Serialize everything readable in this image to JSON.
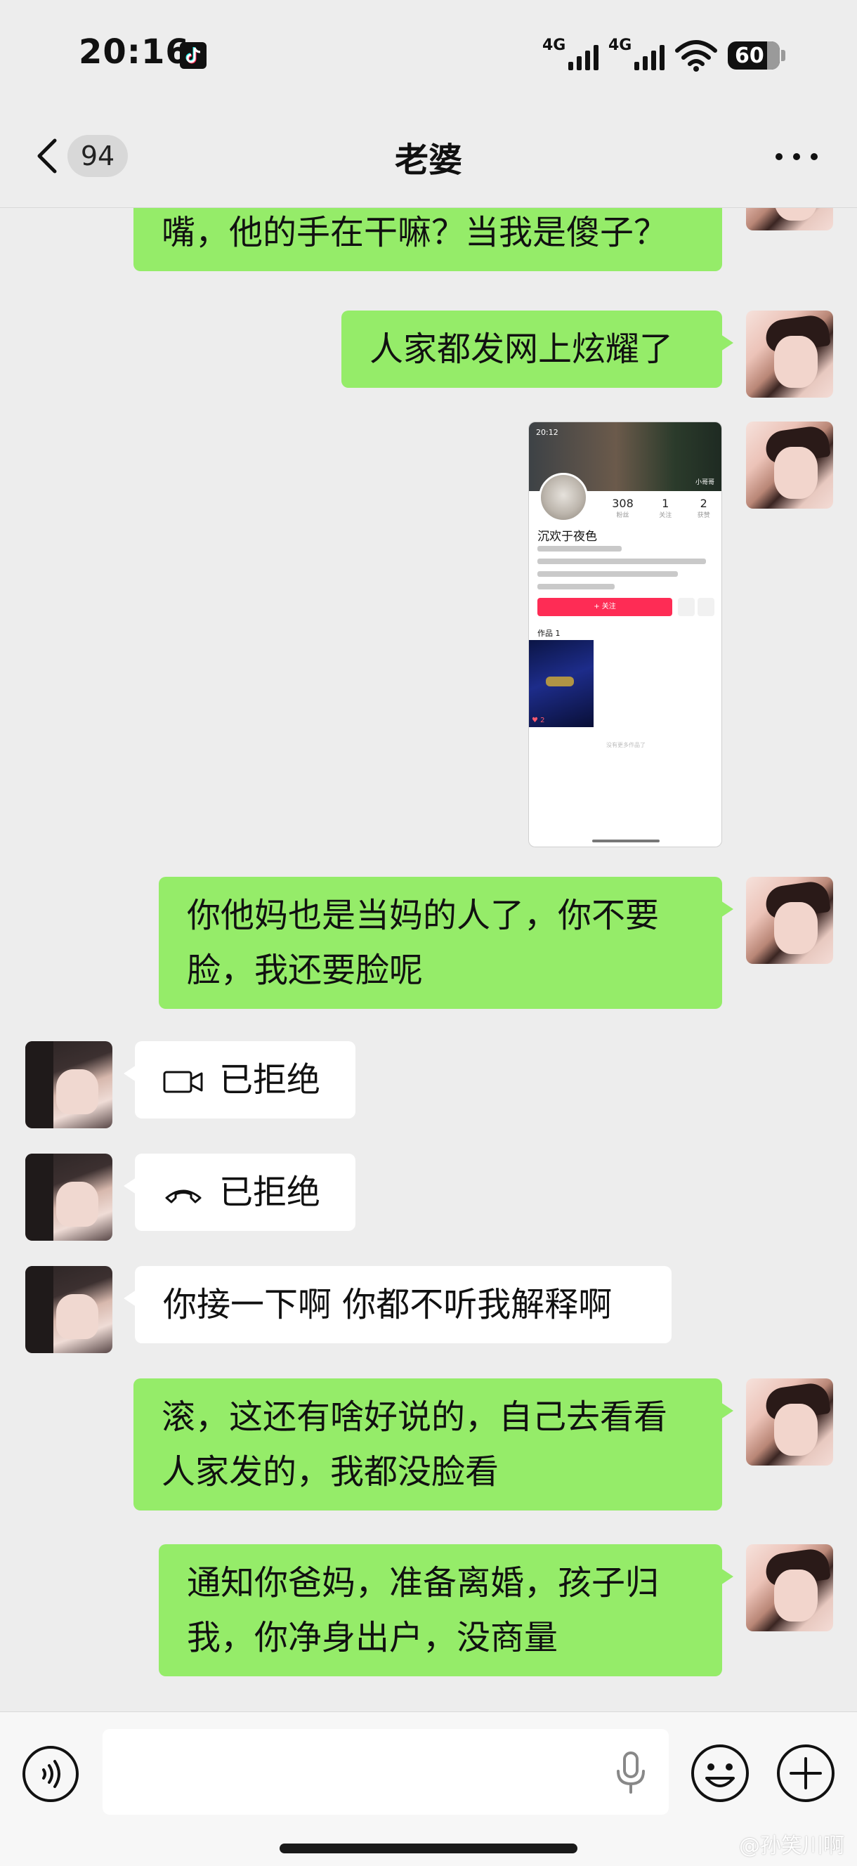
{
  "status_bar": {
    "time": "20:16",
    "network_1": "4G",
    "network_2": "4G",
    "battery": "60",
    "icons": [
      "tiktok-icon",
      "signal-icon",
      "signal-icon",
      "wifi-icon",
      "battery-icon"
    ]
  },
  "header": {
    "unread_count": "94",
    "title": "老婆",
    "icons": [
      "back-icon",
      "more-icon"
    ]
  },
  "messages": [
    {
      "side": "right",
      "type": "text",
      "text": "嘴，他的手在干嘛？当我是傻子？"
    },
    {
      "side": "right",
      "type": "text",
      "text": "人家都发网上炫耀了"
    },
    {
      "side": "right",
      "type": "image",
      "screenshot": {
        "time": "20:12",
        "banner_label": "小哥哥",
        "stats": [
          {
            "value": "308",
            "label": "粉丝"
          },
          {
            "value": "1",
            "label": "关注"
          },
          {
            "value": "2",
            "label": "获赞"
          }
        ],
        "nickname": "沉欢于夜色",
        "follow_button": "+ 关注",
        "works_label": "作品 1",
        "likes": "♥ 2",
        "end_tip": "没有更多作品了"
      }
    },
    {
      "side": "right",
      "type": "text",
      "lines": [
        "你他妈也是当妈的人了，你不要",
        "脸，我还要脸呢"
      ]
    },
    {
      "side": "left",
      "type": "call",
      "call_kind": "video",
      "text": "已拒绝"
    },
    {
      "side": "left",
      "type": "call",
      "call_kind": "voice",
      "text": "已拒绝"
    },
    {
      "side": "left",
      "type": "text",
      "text": "你接一下啊 你都不听我解释啊"
    },
    {
      "side": "right",
      "type": "text",
      "lines": [
        "滚，这还有啥好说的，自己去看看",
        "人家发的，我都没脸看"
      ]
    },
    {
      "side": "right",
      "type": "text",
      "lines": [
        "通知你爸妈，准备离婚，孩子归",
        "我，你净身出户，没商量"
      ]
    }
  ],
  "input_bar": {
    "value": "",
    "icons": [
      "voice-icon",
      "mic-icon",
      "emoji-icon",
      "plus-icon"
    ]
  },
  "watermark": "@孙笑川啊",
  "colors": {
    "background": "#ededed",
    "bubble_mine": "#95ec69",
    "bubble_theirs": "#ffffff",
    "follow_button": "#fe2c55"
  }
}
